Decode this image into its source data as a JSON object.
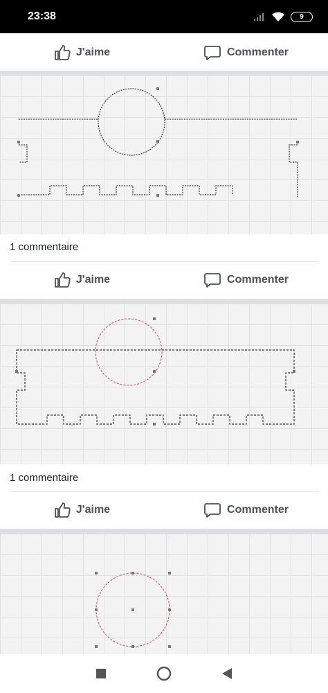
{
  "status_bar": {
    "time": "23:38",
    "battery": "9",
    "icons": [
      "signal-icon",
      "wifi-icon",
      "battery-icon"
    ]
  },
  "actions": {
    "like_label": "J'aime",
    "comment_label": "Commenter"
  },
  "posts": [
    {
      "comment_count": "1 commentaire"
    },
    {
      "comment_count": "1 commentaire"
    }
  ],
  "nav_bar": {
    "icons": [
      "recent-apps-icon",
      "home-icon",
      "back-icon"
    ]
  },
  "colors": {
    "background": "#ffffff",
    "separator": "#dddfe2",
    "action_text": "#4b4f56",
    "grid_bg": "#f3f3f3",
    "sketch_dark": "#333333",
    "sketch_red": "#d06070"
  }
}
